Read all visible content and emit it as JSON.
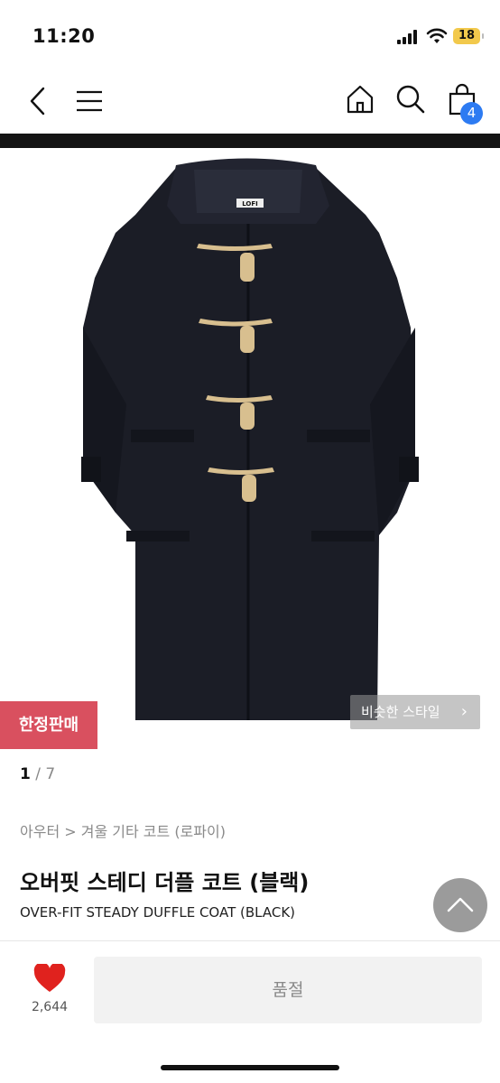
{
  "status_bar": {
    "time": "11:20",
    "battery": "18"
  },
  "nav": {
    "cart_count": "4"
  },
  "hero": {
    "badge": "한정판매",
    "similar_style": "비슷한 스타일"
  },
  "pager": {
    "current": "1",
    "separator": " / ",
    "total": "7"
  },
  "product": {
    "breadcrumb": "아우터 > 겨울 기타 코트 (로파이)",
    "title_ko": "오버핏 스테디 더플 코트 (블랙)",
    "title_en": "OVER-FIT STEADY DUFFLE COAT (BLACK)",
    "brand_label": "LOFI"
  },
  "actions": {
    "like_count": "2,644",
    "soldout_label": "품절"
  },
  "colors": {
    "limited": "#d9505f",
    "cart_badge": "#2d7bf2",
    "heart": "#e0221e"
  }
}
